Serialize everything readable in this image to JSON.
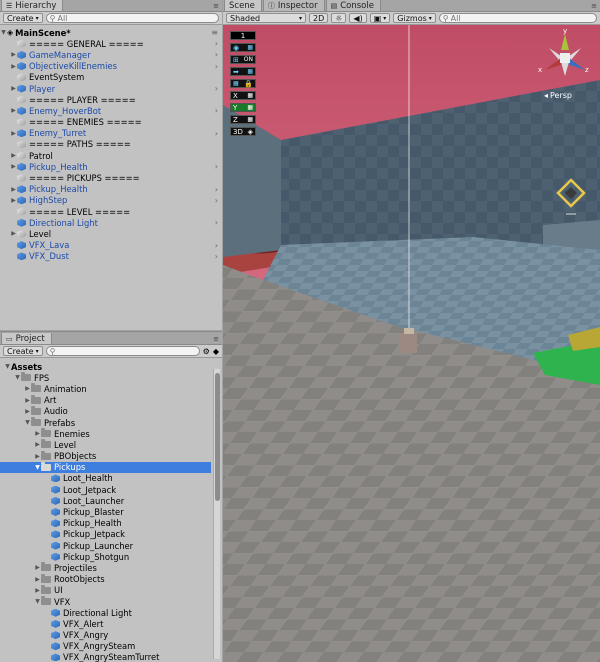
{
  "hierarchy": {
    "tab_label": "Hierarchy",
    "create_label": "Create",
    "search_placeholder": "All",
    "scene_name": "MainScene*",
    "items": [
      {
        "label": "===== GENERAL =====",
        "type": "gray",
        "arrow": "",
        "chev": true
      },
      {
        "label": "GameManager",
        "type": "blue",
        "arrow": "▶",
        "chev": true
      },
      {
        "label": "ObjectiveKillEnemies",
        "type": "blue",
        "arrow": "▶",
        "chev": true
      },
      {
        "label": "EventSystem",
        "type": "gray",
        "arrow": "",
        "chev": false
      },
      {
        "label": "Player",
        "type": "blue",
        "arrow": "▶",
        "chev": true
      },
      {
        "label": "===== PLAYER =====",
        "type": "gray",
        "arrow": "",
        "chev": false
      },
      {
        "label": "Enemy_HoverBot",
        "type": "blue",
        "arrow": "▶",
        "chev": true
      },
      {
        "label": "===== ENEMIES =====",
        "type": "gray",
        "arrow": "",
        "chev": false
      },
      {
        "label": "Enemy_Turret",
        "type": "blue",
        "arrow": "▶",
        "chev": true
      },
      {
        "label": "===== PATHS =====",
        "type": "gray",
        "arrow": "",
        "chev": false
      },
      {
        "label": "Patrol",
        "type": "gray",
        "arrow": "▶",
        "chev": false
      },
      {
        "label": "Pickup_Health",
        "type": "blue",
        "arrow": "▶",
        "chev": true
      },
      {
        "label": "===== PICKUPS =====",
        "type": "gray",
        "arrow": "",
        "chev": false
      },
      {
        "label": "Pickup_Health",
        "type": "blue",
        "arrow": "▶",
        "chev": true
      },
      {
        "label": "HighStep",
        "type": "blue",
        "arrow": "▶",
        "chev": true
      },
      {
        "label": "===== LEVEL =====",
        "type": "gray",
        "arrow": "",
        "chev": false
      },
      {
        "label": "Directional Light",
        "type": "blue",
        "arrow": "",
        "chev": true
      },
      {
        "label": "Level",
        "type": "gray",
        "arrow": "▶",
        "chev": false
      },
      {
        "label": "VFX_Lava",
        "type": "blue",
        "arrow": "",
        "chev": true
      },
      {
        "label": "VFX_Dust",
        "type": "blue",
        "arrow": "",
        "chev": true
      }
    ]
  },
  "project": {
    "tab_label": "Project",
    "create_label": "Create",
    "search_placeholder": "",
    "tree": [
      {
        "label": "Assets",
        "depth": 0,
        "arrow": "▼",
        "kind": "root",
        "selected": false
      },
      {
        "label": "FPS",
        "depth": 1,
        "arrow": "▼",
        "kind": "folder",
        "selected": false
      },
      {
        "label": "Animation",
        "depth": 2,
        "arrow": "▶",
        "kind": "folder",
        "selected": false
      },
      {
        "label": "Art",
        "depth": 2,
        "arrow": "▶",
        "kind": "folder",
        "selected": false
      },
      {
        "label": "Audio",
        "depth": 2,
        "arrow": "▶",
        "kind": "folder",
        "selected": false
      },
      {
        "label": "Prefabs",
        "depth": 2,
        "arrow": "▼",
        "kind": "folder",
        "selected": false
      },
      {
        "label": "Enemies",
        "depth": 3,
        "arrow": "▶",
        "kind": "folder",
        "selected": false
      },
      {
        "label": "Level",
        "depth": 3,
        "arrow": "▶",
        "kind": "folder",
        "selected": false
      },
      {
        "label": "PBObjects",
        "depth": 3,
        "arrow": "▶",
        "kind": "folder",
        "selected": false
      },
      {
        "label": "Pickups",
        "depth": 3,
        "arrow": "▼",
        "kind": "folder",
        "selected": true
      },
      {
        "label": "Loot_Health",
        "depth": 4,
        "arrow": "",
        "kind": "prefab",
        "selected": false
      },
      {
        "label": "Loot_Jetpack",
        "depth": 4,
        "arrow": "",
        "kind": "prefab",
        "selected": false
      },
      {
        "label": "Loot_Launcher",
        "depth": 4,
        "arrow": "",
        "kind": "prefab",
        "selected": false
      },
      {
        "label": "Pickup_Blaster",
        "depth": 4,
        "arrow": "",
        "kind": "prefab",
        "selected": false
      },
      {
        "label": "Pickup_Health",
        "depth": 4,
        "arrow": "",
        "kind": "prefab",
        "selected": false
      },
      {
        "label": "Pickup_Jetpack",
        "depth": 4,
        "arrow": "",
        "kind": "prefab",
        "selected": false
      },
      {
        "label": "Pickup_Launcher",
        "depth": 4,
        "arrow": "",
        "kind": "prefab",
        "selected": false
      },
      {
        "label": "Pickup_Shotgun",
        "depth": 4,
        "arrow": "",
        "kind": "prefab",
        "selected": false
      },
      {
        "label": "Projectiles",
        "depth": 3,
        "arrow": "▶",
        "kind": "folder",
        "selected": false
      },
      {
        "label": "RootObjects",
        "depth": 3,
        "arrow": "▶",
        "kind": "folder",
        "selected": false
      },
      {
        "label": "UI",
        "depth": 3,
        "arrow": "▶",
        "kind": "folder",
        "selected": false
      },
      {
        "label": "VFX",
        "depth": 3,
        "arrow": "▼",
        "kind": "folder",
        "selected": false
      },
      {
        "label": "Directional Light",
        "depth": 4,
        "arrow": "",
        "kind": "prefab",
        "selected": false
      },
      {
        "label": "VFX_Alert",
        "depth": 4,
        "arrow": "",
        "kind": "prefab",
        "selected": false
      },
      {
        "label": "VFX_Angry",
        "depth": 4,
        "arrow": "",
        "kind": "prefab",
        "selected": false
      },
      {
        "label": "VFX_AngrySteam",
        "depth": 4,
        "arrow": "",
        "kind": "prefab",
        "selected": false
      },
      {
        "label": "VFX_AngrySteamTurret",
        "depth": 4,
        "arrow": "",
        "kind": "prefab",
        "selected": false
      }
    ]
  },
  "scene": {
    "tabs": [
      "Scene",
      "Inspector",
      "Console"
    ],
    "shading_label": "Shaded",
    "mode_2d_label": "2D",
    "gizmos_label": "Gizmos",
    "search_placeholder": "All",
    "persp_label": "Persp",
    "gizmo_axis_y": "y",
    "gizmo_axis_x": "x",
    "gizmo_axis_z": "z",
    "overlay": {
      "counter": "1",
      "on_label": "ON",
      "axis_x": "X",
      "axis_y": "Y",
      "axis_z": "Z",
      "mode_3d": "3D"
    }
  },
  "colors": {
    "selection": "#3d7ede",
    "sky": "#c85a70",
    "wall": "#4b5f6e",
    "floor": "#8d8b88",
    "prefab_text": "#1c4aa8"
  }
}
